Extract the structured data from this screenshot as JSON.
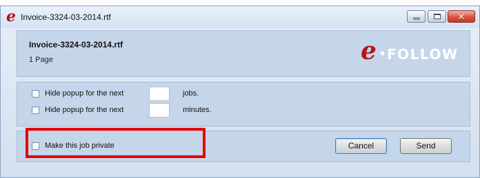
{
  "window": {
    "title": "Invoice-3324-03-2014.rtf",
    "title_icon": "efollow-logo-icon",
    "controls": {
      "minimize": "minimize-icon",
      "maximize": "maximize-icon",
      "close": "close-icon"
    }
  },
  "header": {
    "file_name": "Invoice-3324-03-2014.rtf",
    "page_count": "1 Page",
    "brand_letter": "e",
    "brand_text": "FOLLOW"
  },
  "options": [
    {
      "label": "Hide popup for the next",
      "value": "",
      "unit": "jobs."
    },
    {
      "label": "Hide popup for the next",
      "value": "",
      "unit": "minutes."
    }
  ],
  "footer": {
    "private_label": "Make this job private",
    "cancel_label": "Cancel",
    "send_label": "Send"
  },
  "colors": {
    "accent": "#b3141a",
    "panel": "#c6d6ea",
    "highlight": "#e80000"
  }
}
